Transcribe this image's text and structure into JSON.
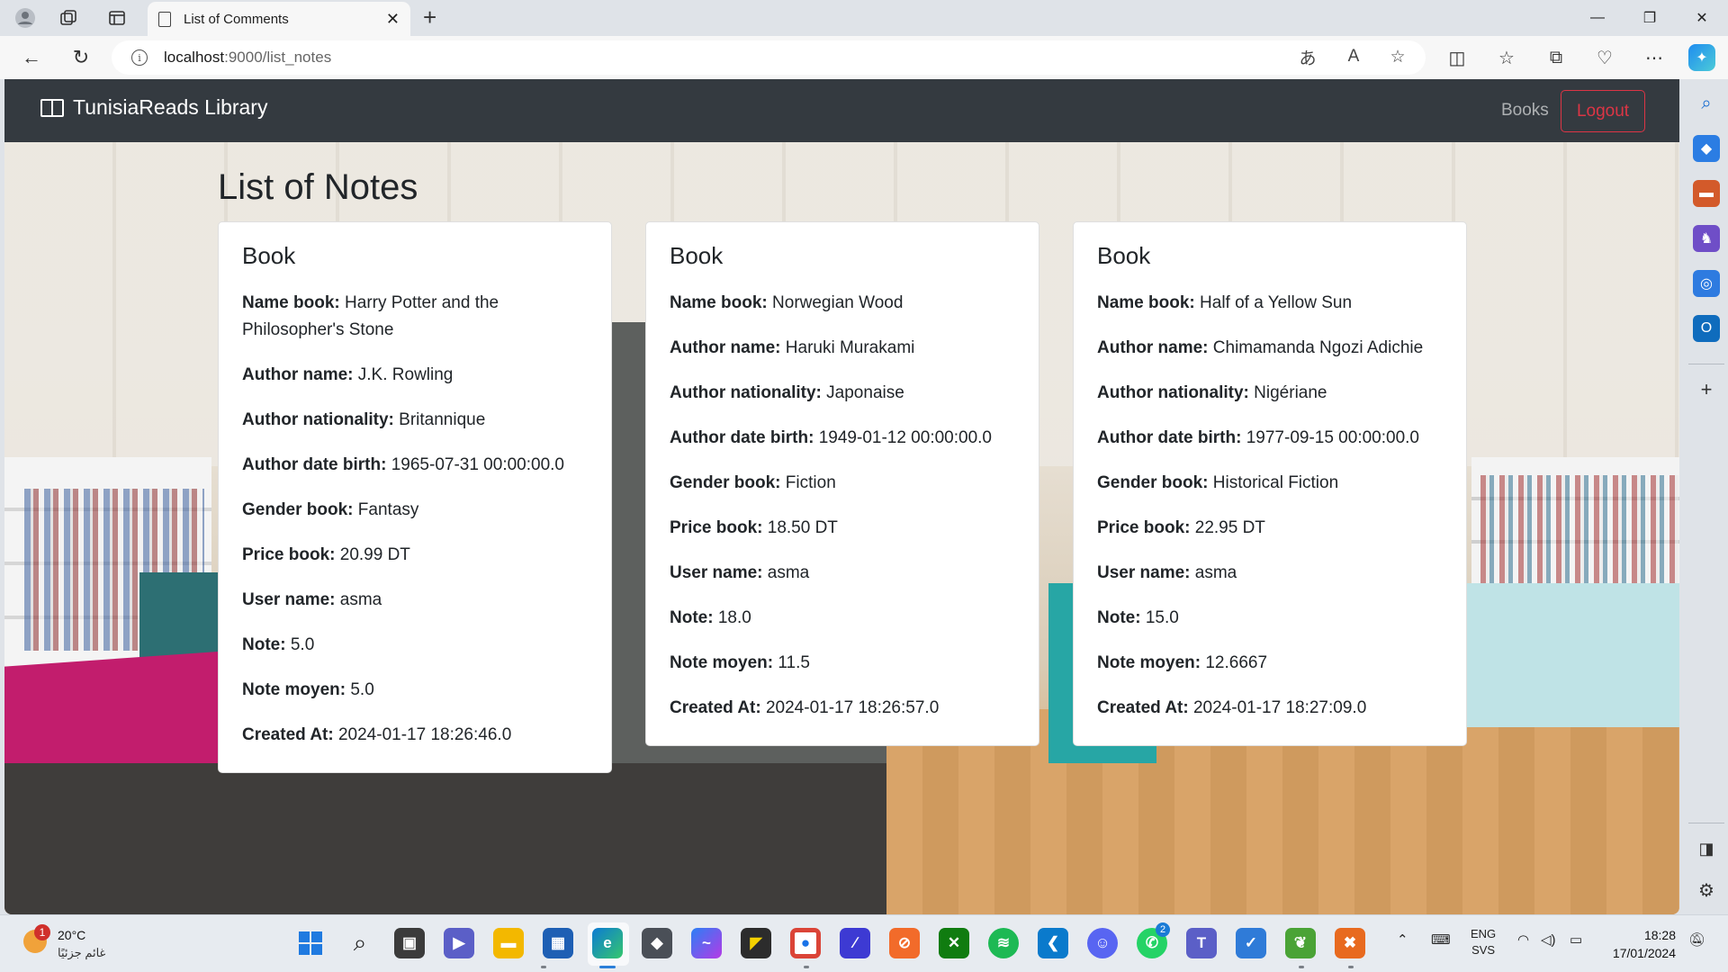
{
  "browser": {
    "tab_title": "List of Comments",
    "url_host": "localhost",
    "url_path": ":9000/list_notes"
  },
  "navbar": {
    "brand": "TunisiaReads Library",
    "books_link": "Books",
    "logout_button": "Logout"
  },
  "page": {
    "title": "List of Notes"
  },
  "labels": {
    "card_title": "Book",
    "name_book": "Name book:",
    "author_name": "Author name:",
    "author_nationality": "Author nationality:",
    "author_date_birth": "Author date birth:",
    "gender_book": "Gender book:",
    "price_book": "Price book:",
    "user_name": "User name:",
    "note": "Note:",
    "note_moyen": "Note moyen:",
    "created_at": "Created At:"
  },
  "notes": [
    {
      "name_book": "Harry Potter and the Philosopher's Stone",
      "author_name": "J.K. Rowling",
      "author_nationality": "Britannique",
      "author_date_birth": "1965-07-31 00:00:00.0",
      "gender_book": "Fantasy",
      "price_book": "20.99 DT",
      "user_name": "asma",
      "note": "5.0",
      "note_moyen": "5.0",
      "created_at": "2024-01-17 18:26:46.0"
    },
    {
      "name_book": "Norwegian Wood",
      "author_name": "Haruki Murakami",
      "author_nationality": "Japonaise",
      "author_date_birth": "1949-01-12 00:00:00.0",
      "gender_book": "Fiction",
      "price_book": "18.50 DT",
      "user_name": "asma",
      "note": "18.0",
      "note_moyen": "11.5",
      "created_at": "2024-01-17 18:26:57.0"
    },
    {
      "name_book": "Half of a Yellow Sun",
      "author_name": "Chimamanda Ngozi Adichie",
      "author_nationality": "Nigériane",
      "author_date_birth": "1977-09-15 00:00:00.0",
      "gender_book": "Historical Fiction",
      "price_book": "22.95 DT",
      "user_name": "asma",
      "note": "15.0",
      "note_moyen": "12.6667",
      "created_at": "2024-01-17 18:27:09.0"
    }
  ],
  "taskbar": {
    "weather_temp": "20°C",
    "weather_condition": "غائم جزئيًا",
    "weather_badge": "1",
    "whatsapp_badge": "2",
    "lang_1": "ENG",
    "lang_2": "SVS",
    "time": "18:28",
    "date": "17/01/2024"
  }
}
